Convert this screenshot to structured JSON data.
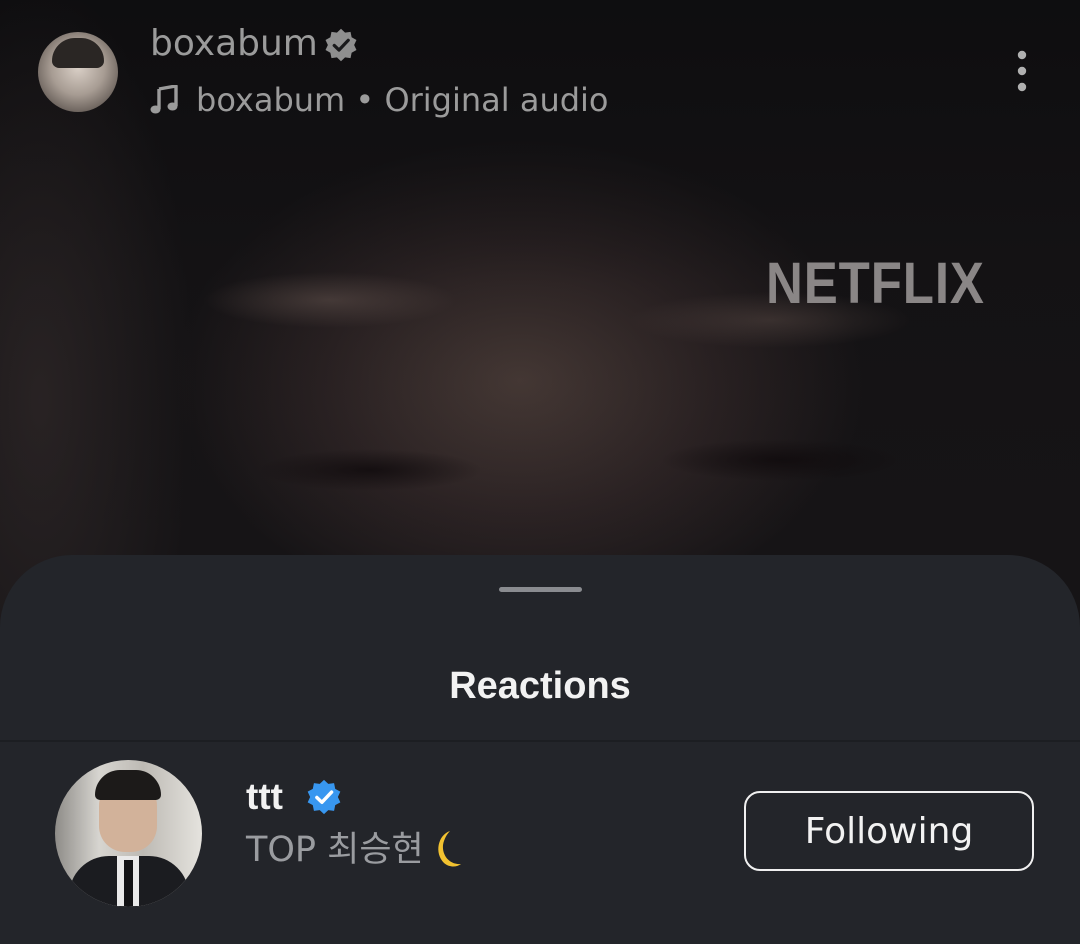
{
  "video": {
    "watermark": "NETFLIX"
  },
  "header": {
    "username": "boxabum",
    "verified_icon": "verified-badge-icon",
    "audio_icon": "music-note-icon",
    "audio_text": "boxabum • Original audio",
    "menu_icon": "more-vertical-icon"
  },
  "sheet": {
    "title": "Reactions",
    "reactions": [
      {
        "username": "ttt",
        "verified": true,
        "display_name": "TOP 최승현",
        "display_name_icon": "crescent-moon-emoji",
        "button_label": "Following"
      }
    ]
  },
  "colors": {
    "sheet_background": "#23252a",
    "verified_blue": "#3897f0",
    "text_primary": "#f2f2f2",
    "text_secondary": "#9a9ca0",
    "moon": "#f2c230"
  }
}
